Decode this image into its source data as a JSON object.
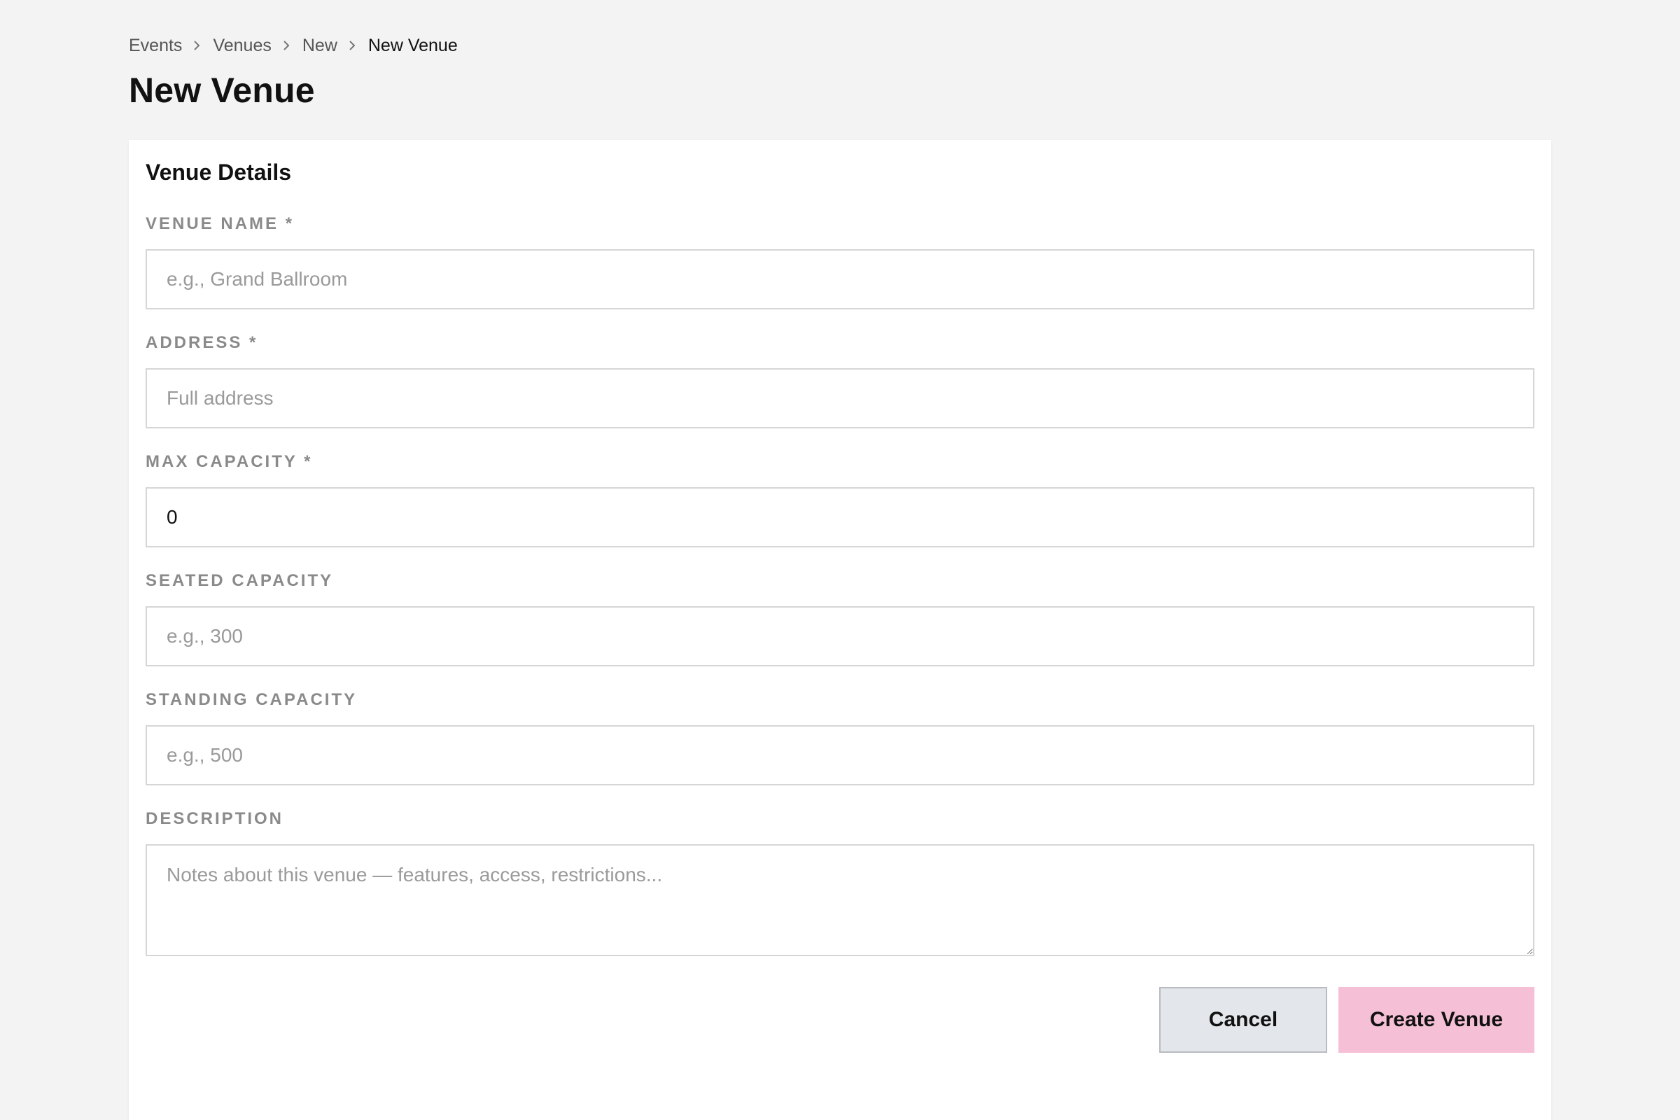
{
  "breadcrumb": {
    "items": [
      "Events",
      "Venues",
      "New"
    ],
    "current": "New Venue"
  },
  "page": {
    "title": "New Venue"
  },
  "form": {
    "section_title": "Venue Details",
    "fields": {
      "venue_name": {
        "label": "VENUE NAME *",
        "placeholder": "e.g., Grand Ballroom",
        "value": ""
      },
      "address": {
        "label": "ADDRESS *",
        "placeholder": "Full address",
        "value": ""
      },
      "max_capacity": {
        "label": "MAX CAPACITY *",
        "placeholder": "",
        "value": "0"
      },
      "seated_capacity": {
        "label": "SEATED CAPACITY",
        "placeholder": "e.g., 300",
        "value": ""
      },
      "standing_capacity": {
        "label": "STANDING CAPACITY",
        "placeholder": "e.g., 500",
        "value": ""
      },
      "description": {
        "label": "DESCRIPTION",
        "placeholder": "Notes about this venue — features, access, restrictions...",
        "value": ""
      }
    },
    "buttons": {
      "cancel": "Cancel",
      "create": "Create Venue"
    }
  },
  "colors": {
    "background": "#f3f3f3",
    "card": "#ffffff",
    "primary_button": "#f5c0d6",
    "secondary_button": "#e3e6ea",
    "label": "#8a8a8a"
  },
  "icons": {
    "breadcrumb_separator": "chevron-right-icon"
  }
}
